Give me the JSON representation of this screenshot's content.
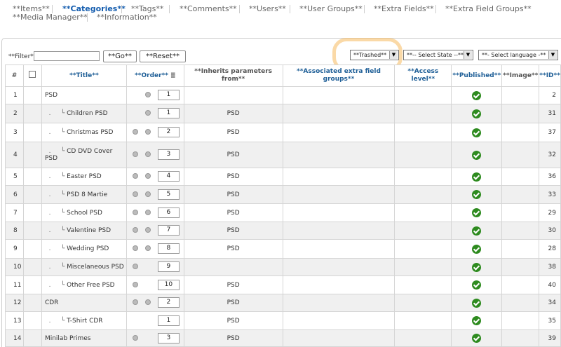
{
  "nav": {
    "items": [
      "**Items**",
      "**Categories**",
      "**Tags**",
      "**Comments**",
      "**Users**",
      "**User Groups**",
      "**Extra Fields**",
      "**Extra Field Groups**",
      "**Media Manager**",
      "**Information**"
    ]
  },
  "filter": {
    "label": "**Filter**",
    "value": "",
    "go": "**Go**",
    "reset": "**Reset**"
  },
  "selects": {
    "trashed": "**Trashed**",
    "state": "**-- Select State --**",
    "language": "**- Select language -**"
  },
  "table": {
    "headers": {
      "num": "#",
      "title": "**Title**",
      "order": "**Order**",
      "inherits": "**Inherits parameters from**",
      "extra_groups": "**Associated extra field groups**",
      "access": "**Access level**",
      "published": "**Published**",
      "image": "**Image**",
      "id": "**ID**"
    },
    "rows": [
      {
        "num": "1",
        "title": "PSD",
        "level": 0,
        "order": "1",
        "inherits": "",
        "id": "2",
        "up": false,
        "down": true
      },
      {
        "num": "2",
        "title": "Children PSD",
        "level": 1,
        "order": "1",
        "inherits": "PSD",
        "id": "31",
        "up": false,
        "down": true
      },
      {
        "num": "3",
        "title": "Christmas PSD",
        "level": 1,
        "order": "2",
        "inherits": "PSD",
        "id": "37",
        "up": true,
        "down": true
      },
      {
        "num": "4",
        "title": "CD DVD Cover PSD",
        "level": 1,
        "order": "3",
        "inherits": "PSD",
        "id": "32",
        "up": true,
        "down": true
      },
      {
        "num": "5",
        "title": "Easter PSD",
        "level": 1,
        "order": "4",
        "inherits": "PSD",
        "id": "36",
        "up": true,
        "down": true
      },
      {
        "num": "6",
        "title": "PSD 8 Martie",
        "level": 1,
        "order": "5",
        "inherits": "PSD",
        "id": "33",
        "up": true,
        "down": true
      },
      {
        "num": "7",
        "title": "School PSD",
        "level": 1,
        "order": "6",
        "inherits": "PSD",
        "id": "29",
        "up": true,
        "down": true
      },
      {
        "num": "8",
        "title": "Valentine PSD",
        "level": 1,
        "order": "7",
        "inherits": "PSD",
        "id": "30",
        "up": true,
        "down": true
      },
      {
        "num": "9",
        "title": "Wedding PSD",
        "level": 1,
        "order": "8",
        "inherits": "PSD",
        "id": "28",
        "up": true,
        "down": true
      },
      {
        "num": "10",
        "title": "Miscelaneous PSD",
        "level": 1,
        "order": "9",
        "inherits": "",
        "id": "38",
        "up": true,
        "down": false
      },
      {
        "num": "11",
        "title": "Other Free PSD",
        "level": 1,
        "order": "10",
        "inherits": "PSD",
        "id": "40",
        "up": true,
        "down": false
      },
      {
        "num": "12",
        "title": "CDR",
        "level": 0,
        "order": "2",
        "inherits": "PSD",
        "id": "34",
        "up": true,
        "down": true
      },
      {
        "num": "13",
        "title": "T-Shirt CDR",
        "level": 1,
        "order": "1",
        "inherits": "PSD",
        "id": "35",
        "up": false,
        "down": false
      },
      {
        "num": "14",
        "title": "Minilab Primes",
        "level": 0,
        "order": "3",
        "inherits": "PSD",
        "id": "39",
        "up": true,
        "down": false
      }
    ]
  }
}
